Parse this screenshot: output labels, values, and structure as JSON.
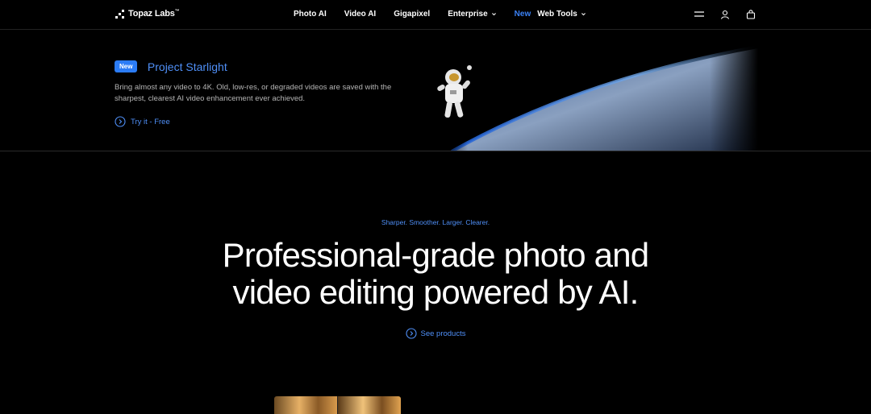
{
  "nav": {
    "logo_text": "Topaz Labs",
    "logo_tm": "™",
    "links": [
      {
        "label": "Photo AI"
      },
      {
        "label": "Video AI"
      },
      {
        "label": "Gigapixel"
      },
      {
        "label": "Enterprise"
      }
    ],
    "new_label": "New",
    "web_tools_label": "Web Tools",
    "icons": [
      "menu-icon",
      "user-icon",
      "cart-icon"
    ]
  },
  "banner": {
    "badge": "New",
    "title": "Project Starlight",
    "description": "Bring almost any video to 4K. Old, low-res, or degraded videos are saved with the sharpest, clearest AI video enhancement ever achieved.",
    "cta": "Try it - Free"
  },
  "hero": {
    "tagline": "Sharper. Smoother. Larger. Clearer.",
    "headline_line1": "Professional-grade photo and",
    "headline_line2": "video editing powered by AI.",
    "cta": "See products"
  },
  "colors": {
    "accent": "#3b82f6",
    "background": "#000000"
  }
}
